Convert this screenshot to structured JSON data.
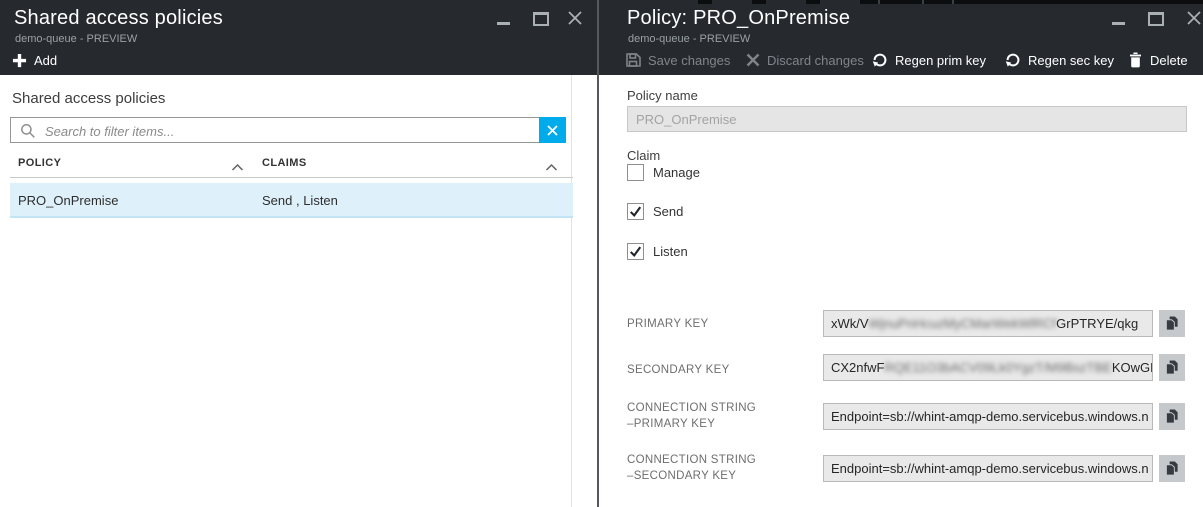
{
  "left_blade": {
    "title": "Shared access policies",
    "subtitle": "demo-queue - PREVIEW",
    "toolbar": {
      "add_label": "Add"
    },
    "section_label": "Shared access policies",
    "search": {
      "placeholder": "Search to filter items..."
    },
    "table": {
      "columns": [
        "POLICY",
        "CLAIMS"
      ],
      "rows": [
        {
          "policy": "PRO_OnPremise",
          "claims": "Send , Listen",
          "selected": true
        }
      ]
    }
  },
  "right_blade": {
    "title": "Policy: PRO_OnPremise",
    "subtitle": "demo-queue - PREVIEW",
    "toolbar": [
      {
        "label": "Save changes",
        "icon": "save-icon",
        "disabled": true
      },
      {
        "label": "Discard changes",
        "icon": "discard-icon",
        "disabled": true
      },
      {
        "label": "Regen prim key",
        "icon": "refresh-icon",
        "disabled": false
      },
      {
        "label": "Regen sec key",
        "icon": "refresh-icon",
        "disabled": false
      },
      {
        "label": "Delete",
        "icon": "trash-icon",
        "disabled": false
      }
    ],
    "form": {
      "policy_name": {
        "label": "Policy name",
        "value": "PRO_OnPremise",
        "disabled": true
      },
      "claim": {
        "label": "Claim",
        "options": [
          {
            "label": "Manage",
            "checked": false
          },
          {
            "label": "Send",
            "checked": true
          },
          {
            "label": "Listen",
            "checked": true
          }
        ]
      },
      "primary_key": {
        "label": "PRIMARY KEY",
        "value_start": "xWk/V",
        "value_redacted": "WjnuPnHcuzMyCMarWekWlRCf",
        "value_end": "GrPTRYE/qkg"
      },
      "secondary_key": {
        "label": "SECONDARY KEY",
        "value_start": "CX2nfwF",
        "value_redacted": "RQE11O3bACV09Lk0YgzT/M9BszTBE",
        "value_end": "KOwGKqr"
      },
      "conn_primary": {
        "label_line1": "CONNECTION STRING",
        "label_line2": "–PRIMARY KEY",
        "value": "Endpoint=sb://whint-amqp-demo.servicebus.windows.n"
      },
      "conn_secondary": {
        "label_line1": "CONNECTION STRING",
        "label_line2": "–SECONDARY KEY",
        "value": "Endpoint=sb://whint-amqp-demo.servicebus.windows.n"
      }
    }
  },
  "icons": {
    "add-icon": "plus",
    "save-icon": "floppy-disk",
    "discard-icon": "x-cross",
    "refresh-icon": "circular-arrow",
    "trash-icon": "trash-can",
    "search-icon": "magnifier",
    "clear-search-icon": "x-cross",
    "copy-icon": "two-pages",
    "sort-ascending-icon": "chevron-up",
    "minimize-icon": "underscore-bar",
    "maximize-icon": "square",
    "close-icon": "x-cross"
  },
  "colors": {
    "header_bg": "#262a2f",
    "accent_blue": "#00abec",
    "selected_row_bg": "#def1fb",
    "disabled_text": "#7f858b",
    "input_disabled_bg": "#e5e5e5",
    "key_field_bg": "#e9e9e9"
  }
}
